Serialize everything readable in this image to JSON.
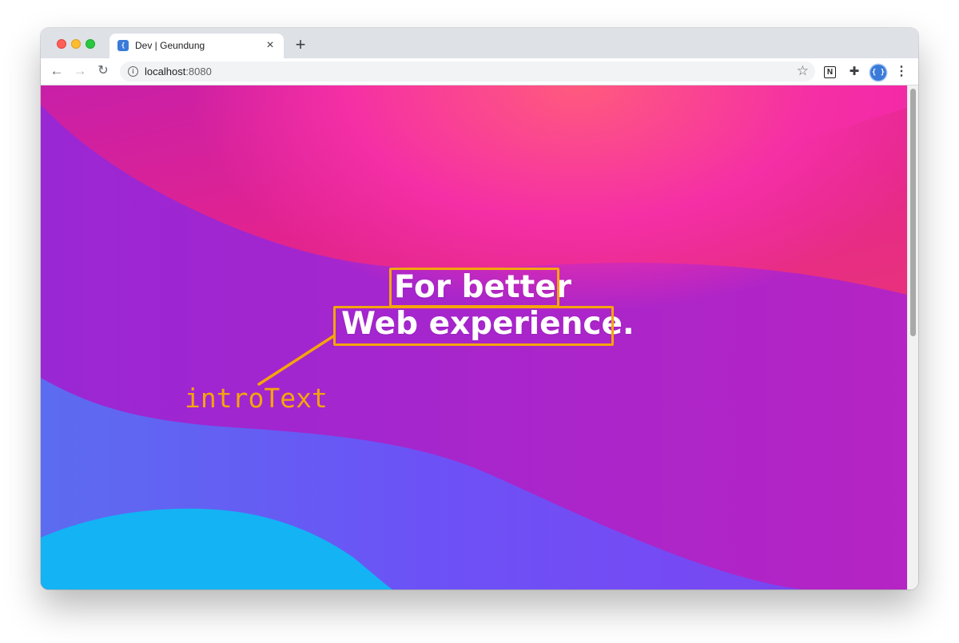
{
  "window": {
    "tab": {
      "title": "Dev | Geundung",
      "favicon": "brackets-icon",
      "favicon_glyph": "{ }",
      "close_glyph": "×"
    },
    "new_tab_glyph": "+"
  },
  "toolbar": {
    "back_glyph": "←",
    "forward_glyph": "→",
    "reload_glyph": "↻",
    "url_host": "localhost",
    "url_port": ":8080",
    "info_glyph": "i",
    "star_glyph": "☆",
    "extensions": {
      "notion_glyph": "N",
      "puzzle_glyph": "✚",
      "avatar_glyph": "{ }",
      "menu_glyph": "⋮"
    }
  },
  "page": {
    "intro_line1": "For better",
    "intro_line2": "Web experience.",
    "annotation_label": "introText",
    "colors": {
      "annotation": "#f5a50a",
      "bg_base": "#a126d2",
      "bg_pink": "#e2238f",
      "bg_hotpink": "#ff3aa0",
      "bg_violet": "#7350f5",
      "bg_cyan": "#14b3f4"
    }
  }
}
